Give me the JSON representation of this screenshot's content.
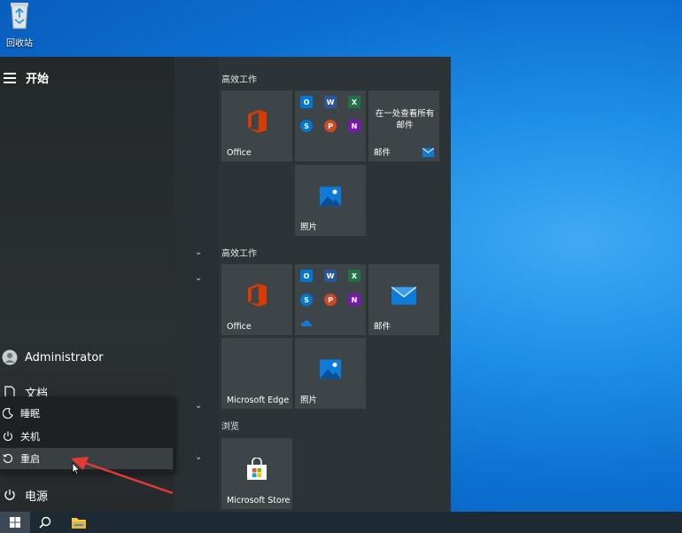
{
  "desktop": {
    "recycle_bin_label": "回收站"
  },
  "start_menu": {
    "title": "开始",
    "user_name": "Administrator",
    "documents_label": "文档",
    "power_label": "电源",
    "power_menu": [
      {
        "label": "睡眠",
        "icon": "moon-icon"
      },
      {
        "label": "关机",
        "icon": "power-icon"
      },
      {
        "label": "重启",
        "icon": "restart-icon",
        "hovered": true
      }
    ]
  },
  "tiles": {
    "group1_label": "高效工作",
    "group2_label": "高效工作",
    "group3_label": "浏览",
    "office_label": "Office",
    "mail_promo_text": "在一处查看所有邮件",
    "mail_label": "邮件",
    "photos_label": "照片",
    "edge_label": "Microsoft Edge",
    "store_label": "Microsoft Store"
  },
  "colors": {
    "office_red": "#d83b01",
    "word_blue": "#2b579a",
    "excel_green": "#217346",
    "skype_blue": "#0078d4",
    "ppt_orange": "#d24726",
    "onenote_purple": "#7719aa",
    "annotation_arrow": "#e53935"
  }
}
